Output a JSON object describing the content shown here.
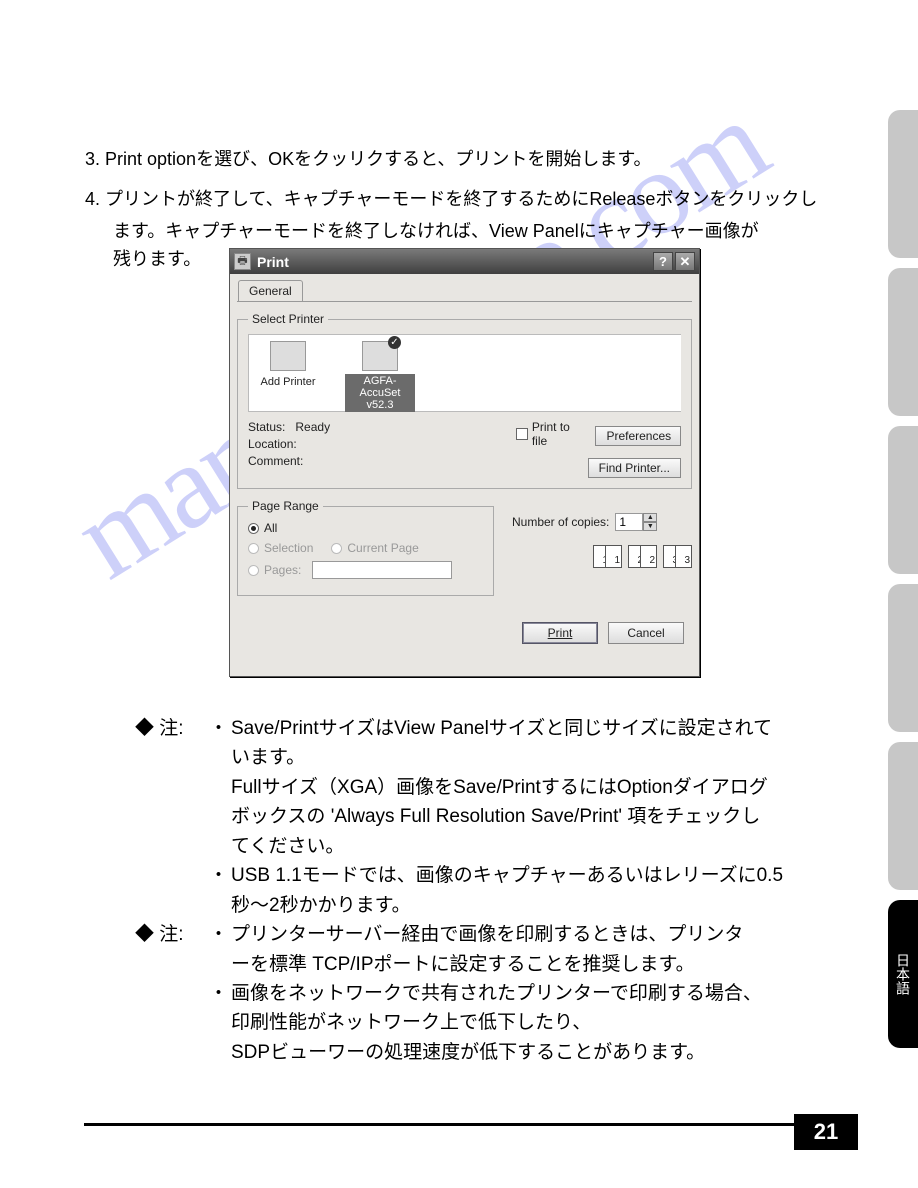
{
  "doc": {
    "item3": "3. Print optionを選び、OKをクッリクすると、プリントを開始します。",
    "item4_l1": "4. プリントが終了して、キャプチャーモードを終了するためにReleaseボタンをクリックし",
    "item4_l2": "ます。キャプチャーモードを終了しなければ、View Panelにキャプチャー画像が",
    "item4_l3": "残ります。"
  },
  "dialog": {
    "title": "Print",
    "tab": "General",
    "select_printer_legend": "Select Printer",
    "printers": {
      "add": "Add Printer",
      "selected_name_l1": "AGFA-AccuSet",
      "selected_name_l2": "v52.3"
    },
    "status_label": "Status:",
    "status_value": "Ready",
    "location_label": "Location:",
    "comment_label": "Comment:",
    "print_to_file": "Print to file",
    "preferences_btn": "Preferences",
    "find_printer_btn": "Find Printer...",
    "page_range_legend": "Page Range",
    "radio_all": "All",
    "radio_selection": "Selection",
    "radio_current": "Current Page",
    "radio_pages": "Pages:",
    "copies_label": "Number of copies:",
    "copies_value": "1",
    "collate_a": "1",
    "collate_b": "1",
    "collate_c": "2",
    "collate_d": "2",
    "collate_e": "3",
    "collate_f": "3",
    "print_btn": "Print",
    "cancel_btn": "Cancel"
  },
  "notes": {
    "label": "◆ 注:",
    "n1_l1": "Save/PrintサイズはView Panelサイズと同じサイズに設定されて",
    "n1_l2": "います。",
    "n1_l3": "Fullサイズ（XGA）画像をSave/PrintするにはOptionダイアログ",
    "n1_l4": "ボックスの 'Always Full Resolution Save/Print' 項をチェックし",
    "n1_l5": "てください。",
    "n2_l1": "USB 1.1モードでは、画像のキャプチャーあるいはレリーズに0.5",
    "n2_l2": "秒〜2秒かかります。",
    "n3_l1": "プリンターサーバー経由で画像を印刷するときは、プリンタ",
    "n3_l2": "ーを標準 TCP/IPポートに設定することを推奨します。",
    "n4_l1": "画像をネットワークで共有されたプリンターで印刷する場合、",
    "n4_l2": "印刷性能がネットワーク上で低下したり、",
    "n4_l3": "SDPビューワーの処理速度が低下することがあります。"
  },
  "sidetab_active": "日本語",
  "page_number": "21",
  "watermark": "manualshive.com"
}
